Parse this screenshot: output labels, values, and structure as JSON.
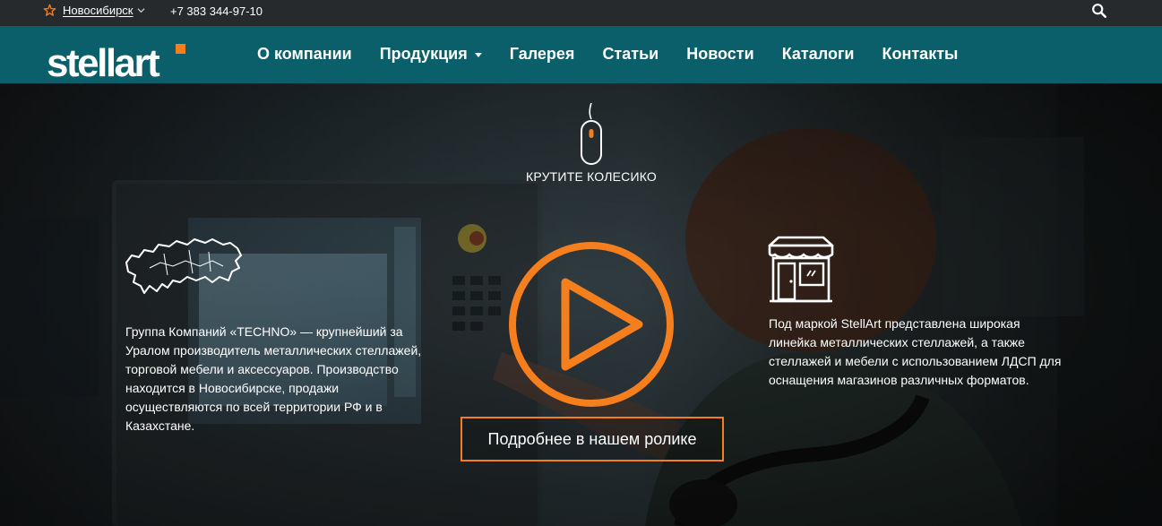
{
  "topbar": {
    "city": "Новосибирск",
    "phone": "+7 383 344-97-10",
    "icons": {
      "city": "star-icon",
      "dropdown": "chevron-down-icon",
      "search": "search-icon"
    }
  },
  "brand": {
    "logo_text": "stellart"
  },
  "nav": {
    "items": [
      {
        "label": "О компании"
      },
      {
        "label": "Продукция",
        "has_dropdown": true
      },
      {
        "label": "Галерея"
      },
      {
        "label": "Статьи"
      },
      {
        "label": "Новости"
      },
      {
        "label": "Каталоги"
      },
      {
        "label": "Контакты"
      }
    ]
  },
  "hero": {
    "scroll_hint": "КРУТИТЕ КОЛЕСИКО",
    "left_text": "Группа Компаний «TECHNO» — крупнейший за Уралом производитель металлических стеллажей, торговой мебели и аксессуаров. Производство находится в Новосибирске, продажи осуществляются по всей территории РФ и в Казахстане.",
    "right_text": "Под маркой StellArt представлена широкая линейка металлических стеллажей, а также стеллажей и мебели с использованием ЛДСП для оснащения магазинов различных форматов.",
    "video_button": "Подробнее в нашем ролике",
    "icons": {
      "scroll": "mouse-icon",
      "left": "russia-map-icon",
      "center": "play-icon",
      "right": "store-icon"
    }
  },
  "colors": {
    "accent": "#f57e1d",
    "nav_bg": "#0a5f6b",
    "topbar_bg": "#262a2d"
  }
}
